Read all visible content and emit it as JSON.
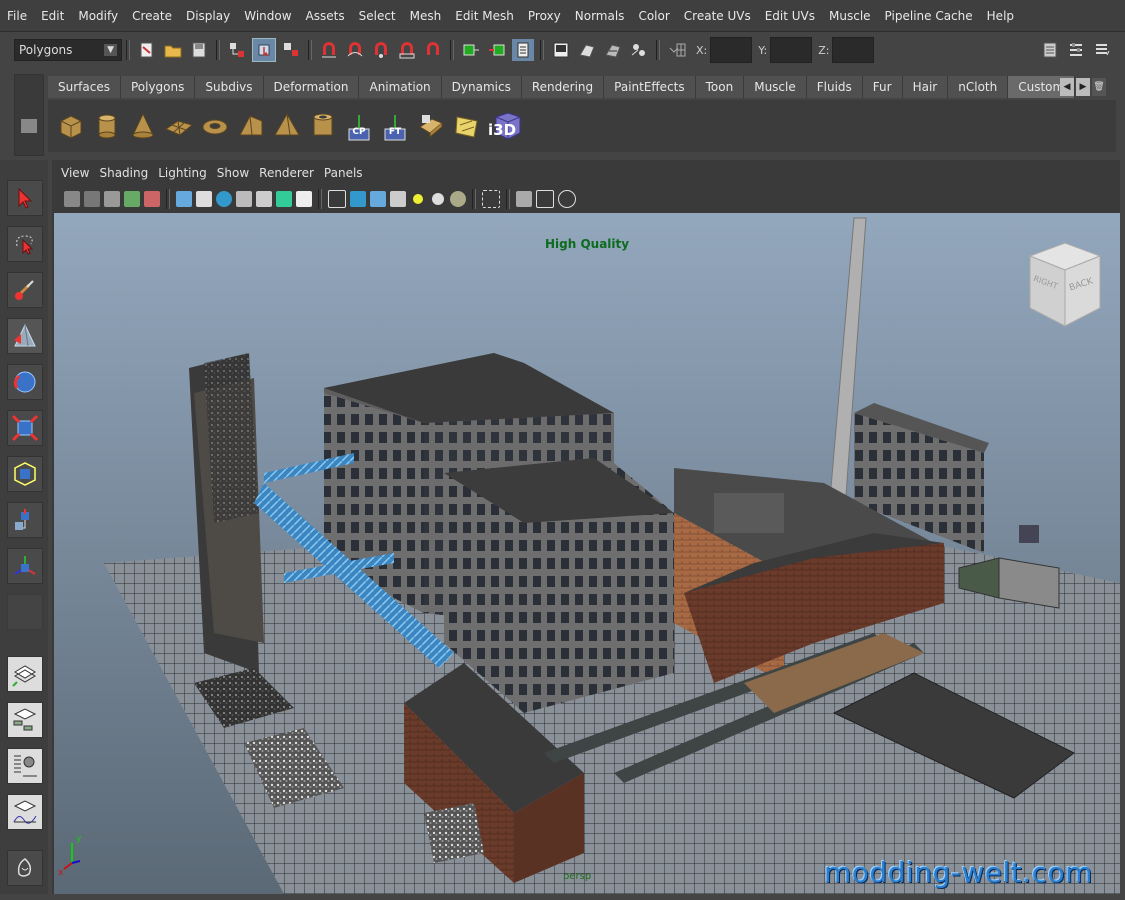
{
  "menubar": {
    "items": [
      "File",
      "Edit",
      "Modify",
      "Create",
      "Display",
      "Window",
      "Assets",
      "Select",
      "Mesh",
      "Edit Mesh",
      "Proxy",
      "Normals",
      "Color",
      "Create UVs",
      "Edit UVs",
      "Muscle",
      "Pipeline Cache",
      "Help"
    ]
  },
  "toolbar": {
    "mode_value": "Polygons",
    "coord_labels": [
      "X:",
      "Y:",
      "Z:"
    ]
  },
  "shelf": {
    "tabs": [
      "Surfaces",
      "Polygons",
      "Subdivs",
      "Deformation",
      "Animation",
      "Dynamics",
      "Rendering",
      "PaintEffects",
      "Toon",
      "Muscle",
      "Fluids",
      "Fur",
      "Hair",
      "nCloth",
      "Custom"
    ],
    "active_tab": "Custom",
    "icons": [
      "poly-cube-icon",
      "poly-cylinder-icon",
      "poly-cone-icon",
      "poly-plane-icon",
      "poly-torus-icon",
      "poly-prism-icon",
      "poly-pyramid-icon",
      "poly-pipe-icon",
      "center-pivot-icon",
      "freeze-transform-icon",
      "uv-icon",
      "uv-layout-icon",
      "i3d-export-icon"
    ],
    "cp_label": "CP",
    "ft_label": "FT",
    "i3d_label": "i3D"
  },
  "panel": {
    "menus": [
      "View",
      "Shading",
      "Lighting",
      "Show",
      "Renderer",
      "Panels"
    ]
  },
  "viewport": {
    "hud_label": "High Quality",
    "viewcube_right": "RIGHT",
    "viewcube_back": "BACK",
    "camera_label": "persp",
    "watermark": "modding-welt.com"
  },
  "colors": {
    "menubar_bg": "#3f3f3f",
    "viewport_top": "#8fa3b9",
    "viewport_bottom": "#5a6875",
    "hud_text": "#0c6b1d",
    "watermark": "#2a7fd0"
  }
}
